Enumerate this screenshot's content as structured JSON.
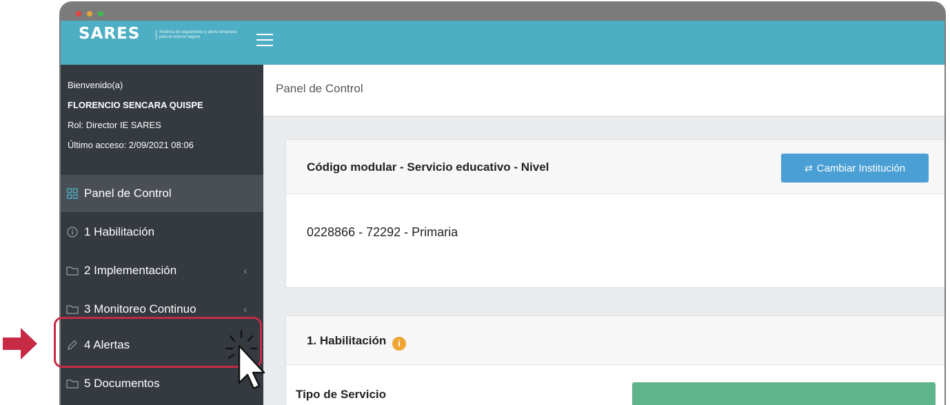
{
  "app": {
    "logo": "SARES",
    "logo_subtitle": "Sistema de seguimiento y alerta temprana para el retorno seguro"
  },
  "colors": {
    "topbar": "#4eaec4",
    "sidebar": "#343a40",
    "button": "#4a9fd5",
    "highlight": "#c72a45"
  },
  "user": {
    "greeting": "Bienvenido(a)",
    "name": "FLORENCIO SENCARA QUISPE",
    "role": "Rol: Director IE SARES",
    "last_access": "Último acceso: 2/09/2021 08:06"
  },
  "sidebar": {
    "items": [
      {
        "label": "Panel de Control",
        "icon": "grid-icon"
      },
      {
        "label": "1 Habilitación",
        "icon": "info-icon"
      },
      {
        "label": "2 Implementación",
        "icon": "folder-icon"
      },
      {
        "label": "3 Monitoreo Continuo",
        "icon": "folder-icon"
      },
      {
        "label": "4 Alertas",
        "icon": "pencil-icon"
      },
      {
        "label": "5 Documentos",
        "icon": "folder-icon"
      }
    ]
  },
  "breadcrumb": "Panel de Control",
  "institution_card": {
    "title": "Código modular - Servicio educativo - Nivel",
    "button_label": "Cambiar Institución",
    "value": "0228866 - 72292 - Primaria"
  },
  "habilitacion_card": {
    "title": "1. Habilitación",
    "field_label": "Tipo de Servicio"
  }
}
